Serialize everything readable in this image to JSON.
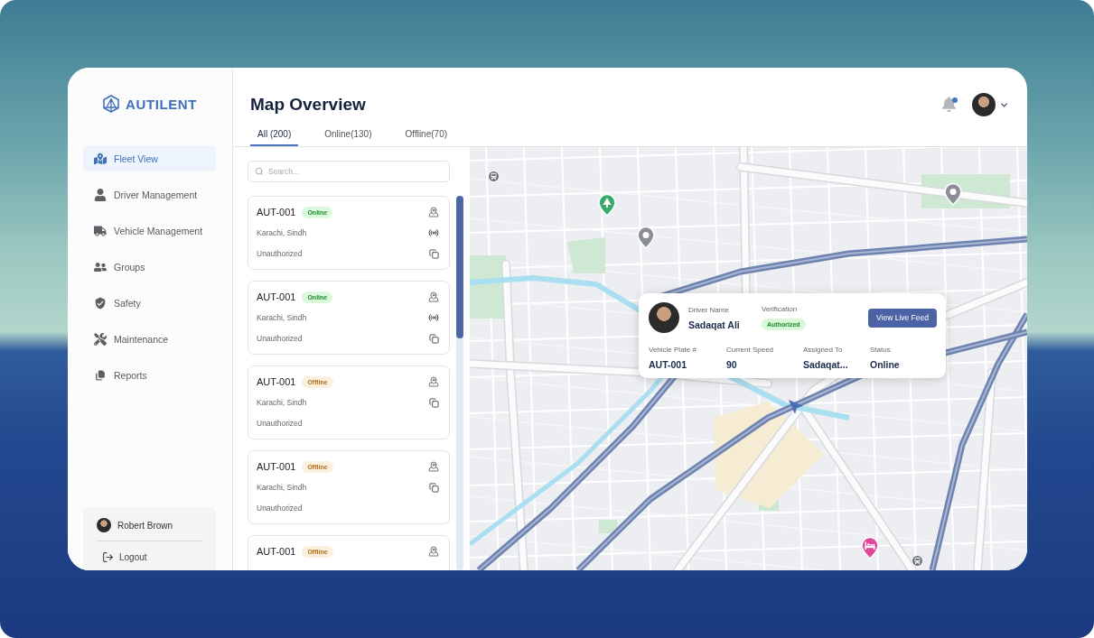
{
  "brand": {
    "name": "AUTILENT"
  },
  "sidebar": {
    "items": [
      {
        "label": "Fleet View",
        "selected": true
      },
      {
        "label": "Driver Management",
        "selected": false
      },
      {
        "label": "Vehicle Management",
        "selected": false
      },
      {
        "label": "Groups",
        "selected": false
      },
      {
        "label": "Safety",
        "selected": false
      },
      {
        "label": "Maintenance",
        "selected": false
      },
      {
        "label": "Reports",
        "selected": false
      }
    ],
    "user": {
      "name": "Robert Brown"
    },
    "logout": {
      "label": "Logout"
    }
  },
  "header": {
    "title": "Map Overview",
    "notification": {
      "unread": true
    }
  },
  "tabs": [
    {
      "label": "All (200)",
      "selected": true
    },
    {
      "label": "Online(130)",
      "selected": false
    },
    {
      "label": "Offline(70)",
      "selected": false
    }
  ],
  "search": {
    "placeholder": "Search..."
  },
  "vehicles": [
    {
      "id": "AUT-001",
      "status": {
        "label": "Online",
        "kind": "online"
      },
      "location": "Karachi, Sindh",
      "authorization": "Unauthorized",
      "live": true
    },
    {
      "id": "AUT-001",
      "status": {
        "label": "Online",
        "kind": "online"
      },
      "location": "Karachi, Sindh",
      "authorization": "Unauthorized",
      "live": true
    },
    {
      "id": "AUT-001",
      "status": {
        "label": "Offline",
        "kind": "offline"
      },
      "location": "Karachi, Sindh",
      "authorization": "Unauthorized",
      "live": false
    },
    {
      "id": "AUT-001",
      "status": {
        "label": "Offline",
        "kind": "offline"
      },
      "location": "Karachi, Sindh",
      "authorization": "Unauthorized",
      "live": false
    },
    {
      "id": "AUT-001",
      "status": {
        "label": "Offline",
        "kind": "offline"
      },
      "live": false
    }
  ],
  "driver_popup": {
    "driver_label": "Driver Name",
    "driver_name": "Sadaqat Ali",
    "verification_label": "Verification",
    "verification": {
      "label": "Authorized",
      "kind": "authorized"
    },
    "button": "View Live Feed",
    "fields": [
      {
        "label": "Vehicle Plate #",
        "value": "AUT-001"
      },
      {
        "label": "Current Speed",
        "value": "90"
      },
      {
        "label": "Assigned To",
        "value": "Sadaqat..."
      },
      {
        "label": "Status",
        "value": "Online"
      }
    ]
  }
}
